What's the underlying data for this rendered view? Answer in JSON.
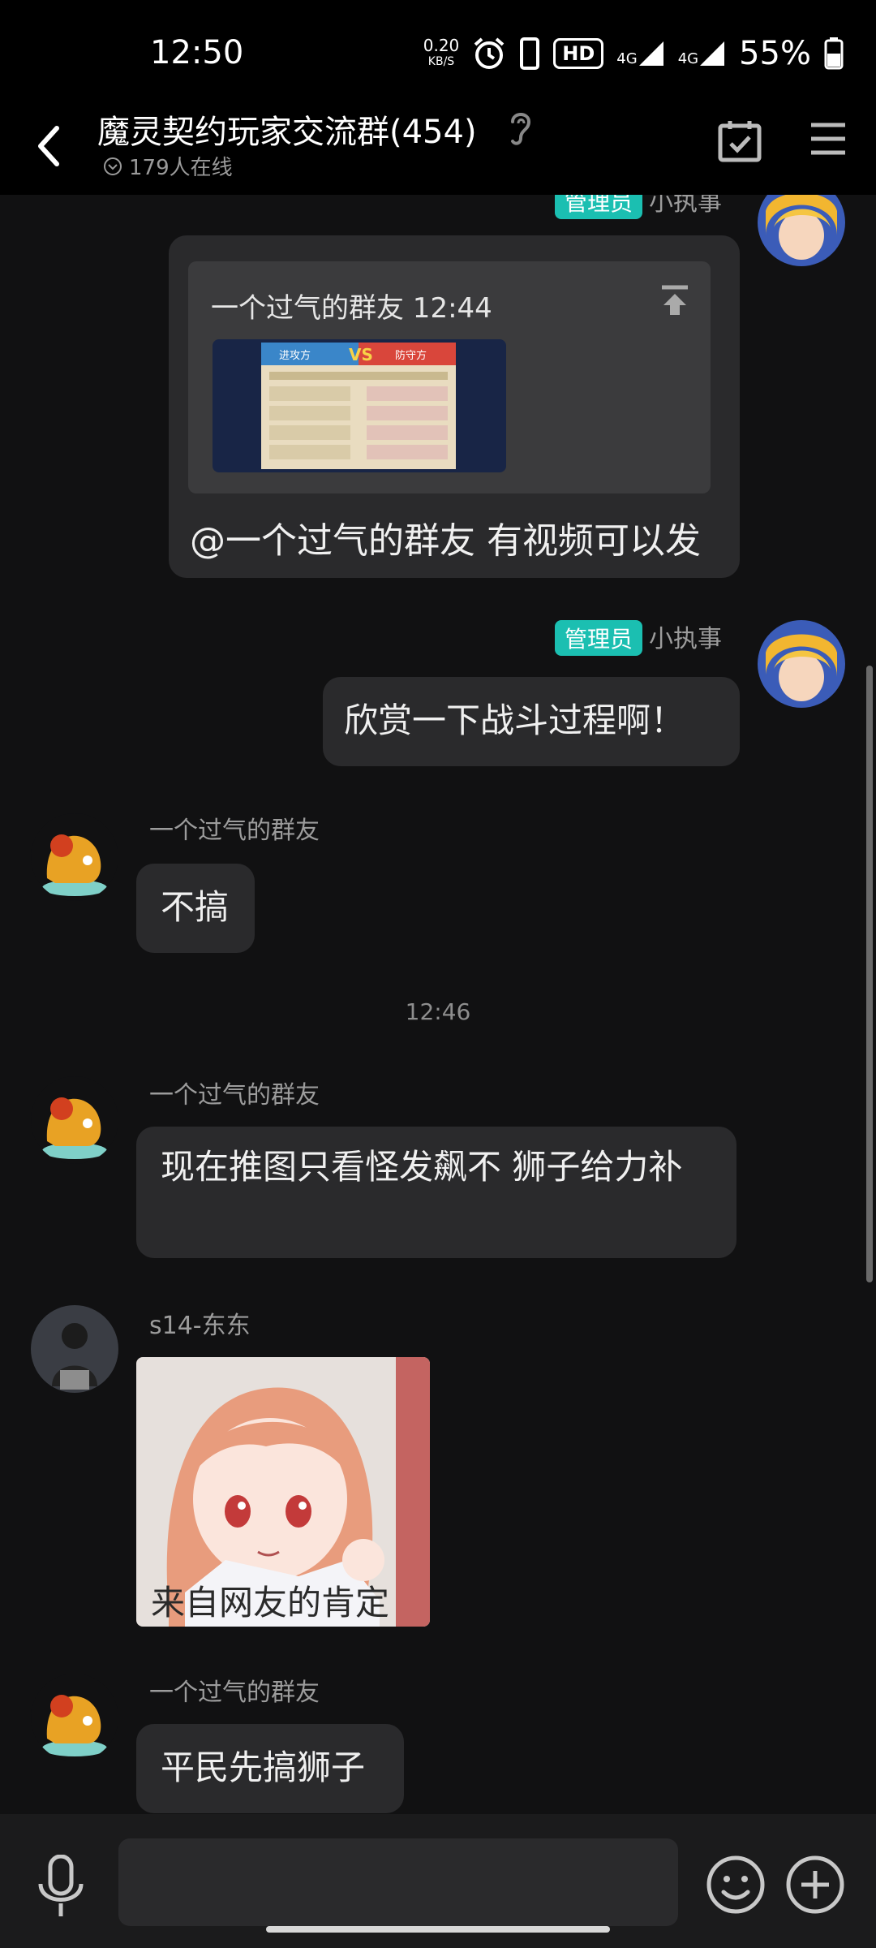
{
  "status_bar": {
    "time": "12:50",
    "net_speed": "0.20",
    "net_unit": "KB/S",
    "hd_label": "HD",
    "sim1": "4G",
    "sim2": "4G",
    "battery": "55%"
  },
  "header": {
    "title": "魔灵契约玩家交流群(454)",
    "online": "179人在线"
  },
  "messages": {
    "m1": {
      "badge": "管理员",
      "sender": "小执事",
      "quote_header": "一个过气的群友 12:44",
      "quote_thumb_left": "进攻方",
      "quote_thumb_vs": "VS",
      "quote_thumb_right": "防守方",
      "text": "@一个过气的群友 有视频可以发"
    },
    "m2": {
      "badge": "管理员",
      "sender": "小执事",
      "text": "欣赏一下战斗过程啊！"
    },
    "m3": {
      "sender": "一个过气的群友",
      "text": "不搞"
    },
    "timestamp": "12:46",
    "m4": {
      "sender": "一个过气的群友",
      "text": "现在推图只看怪发飙不 狮子给力补"
    },
    "m5": {
      "sender": "s14-东东",
      "sticker_caption": "来自网友的肯定"
    },
    "m6": {
      "sender": "一个过气的群友",
      "text": "平民先搞狮子"
    }
  },
  "input": {
    "placeholder": ""
  },
  "colors": {
    "admin_badge": "#1bbfb1",
    "bubble": "#2a2a2c",
    "background": "#111112"
  }
}
